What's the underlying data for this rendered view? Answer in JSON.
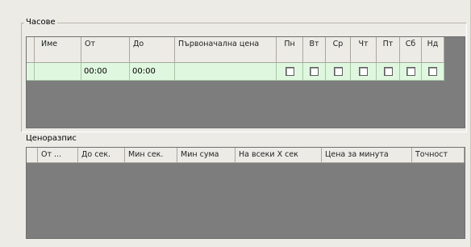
{
  "hours_group": {
    "title": "Часове",
    "columns": [
      "Име",
      "От",
      "До",
      "Първоначална цена",
      "Пн",
      "Вт",
      "Ср",
      "Чт",
      "Пт",
      "Сб",
      "Нд"
    ],
    "rows": [
      {
        "name": "",
        "from": "00:00",
        "to": "00:00",
        "initial_price": "",
        "days": {
          "mon": false,
          "tue": false,
          "wed": false,
          "thu": false,
          "fri": false,
          "sat": false,
          "sun": false
        }
      }
    ]
  },
  "pricing_group": {
    "title": "Ценоразпис",
    "columns": [
      "От ...",
      "До сек.",
      "Мин сек.",
      "Мин сума",
      "На всеки X сек",
      "Цена за минута",
      "Точност"
    ],
    "rows": []
  },
  "colors": {
    "panel_bg": "#ecebe6",
    "grid_empty_bg": "#7d7d7d",
    "selected_row_bg": "#e0f7df"
  }
}
